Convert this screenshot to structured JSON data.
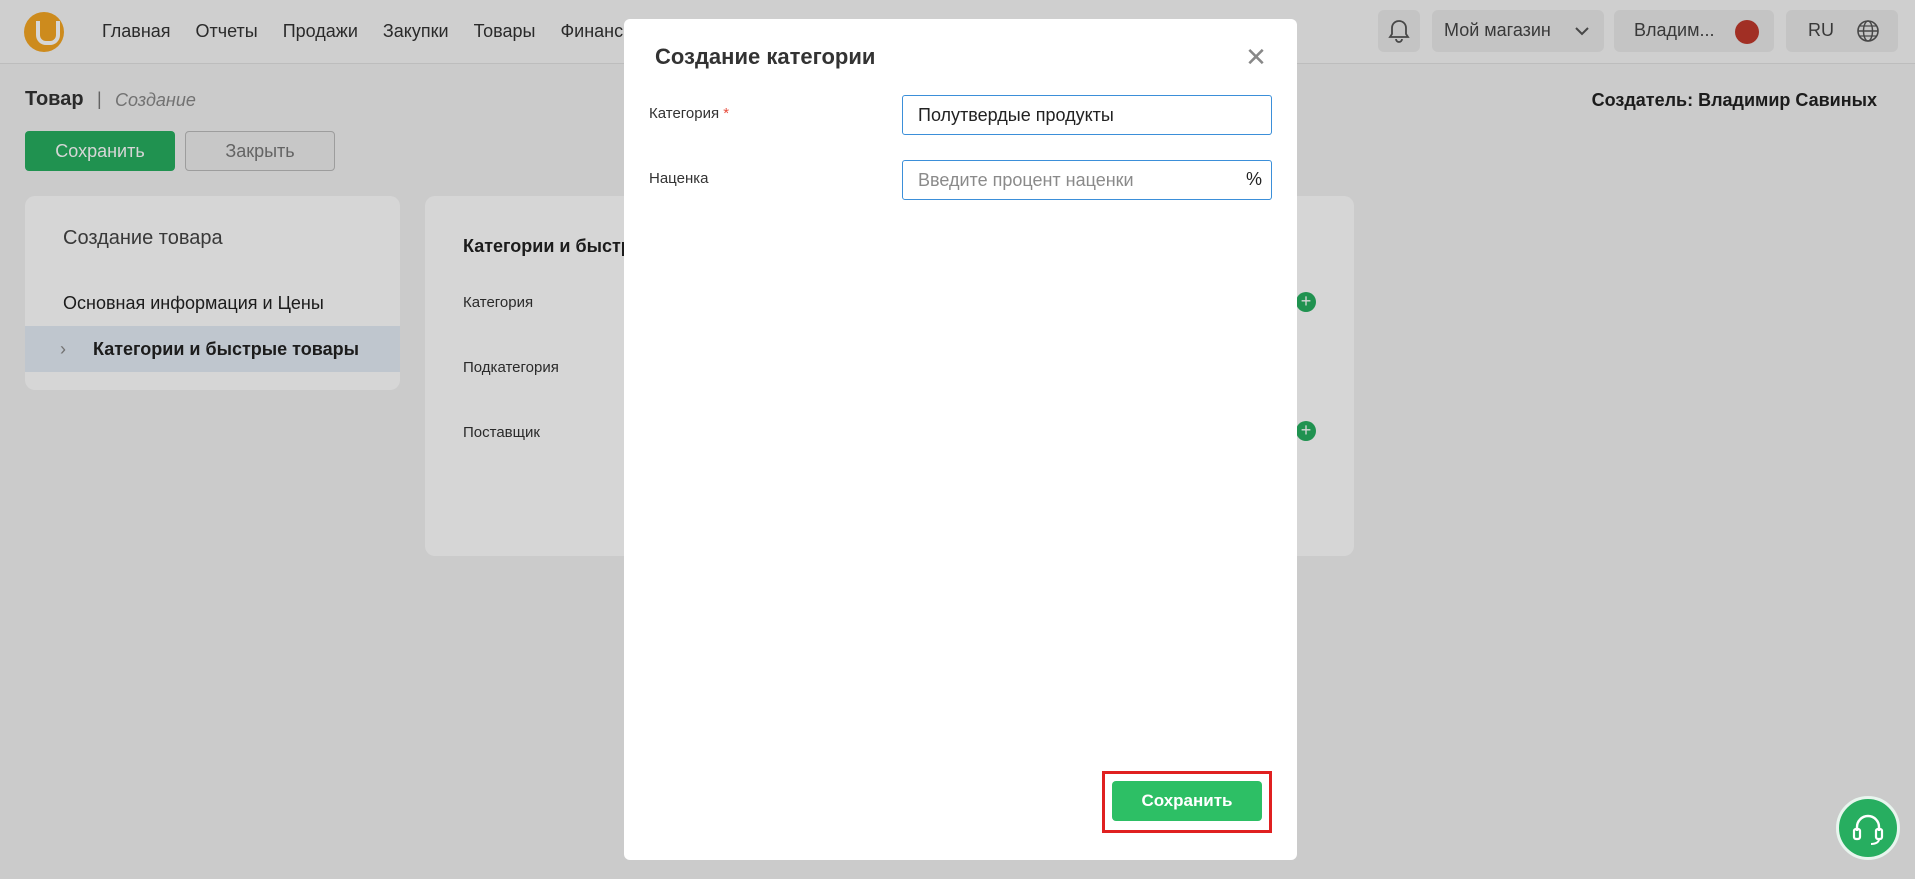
{
  "topbar": {
    "nav": [
      "Главная",
      "Отчеты",
      "Продажи",
      "Закупки",
      "Товары",
      "Финанс"
    ],
    "shop_label": "Мой магазин",
    "user_label": "Владим...",
    "lang_label": "RU"
  },
  "page": {
    "title": "Товар",
    "separator": "|",
    "subtitle": "Создание",
    "creator": "Создатель: Владимир Савиных",
    "save_label": "Сохранить",
    "close_label": "Закрыть"
  },
  "left_card": {
    "title": "Создание товара",
    "items": [
      "Основная информация и Цены",
      "Категории и быстрые товары"
    ]
  },
  "mid_card": {
    "section_title": "Категории и быстры",
    "fields": [
      "Категория",
      "Подкатегория",
      "Поставщик"
    ]
  },
  "modal": {
    "title": "Создание категории",
    "category_label": "Категория",
    "required_mark": "*",
    "category_value": "Полутвердые продукты",
    "markup_label": "Наценка",
    "markup_placeholder": "Введите процент наценки",
    "markup_suffix": "%",
    "save_label": "Сохранить"
  },
  "colors": {
    "accent_green": "#27ae60",
    "logo_orange": "#f5a623",
    "highlight_red": "#e02020",
    "input_border_blue": "#3b8fd9"
  }
}
